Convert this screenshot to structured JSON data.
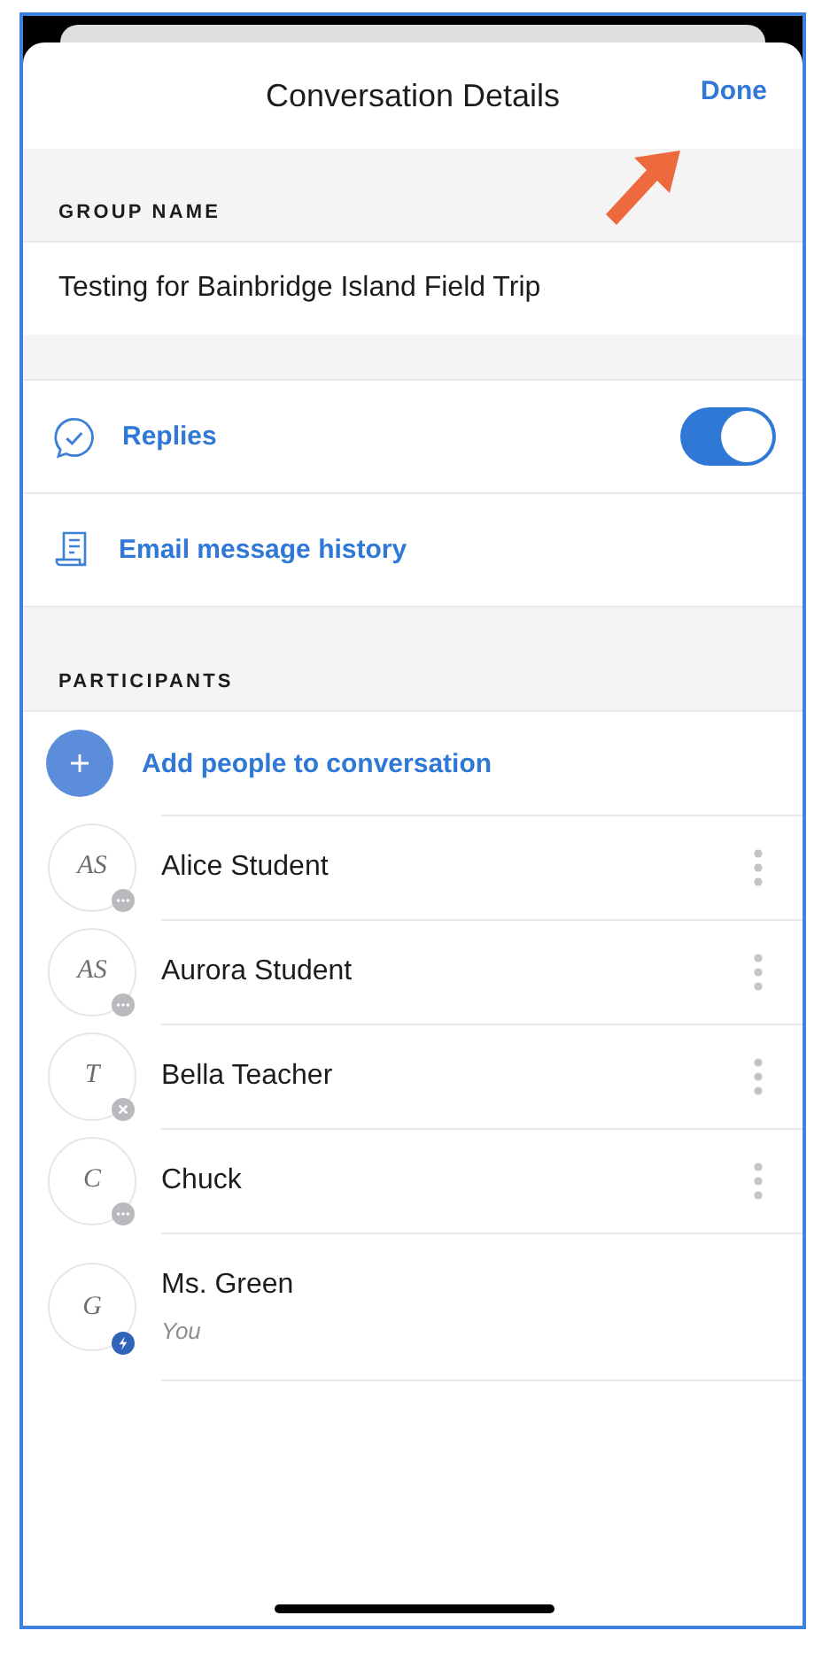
{
  "header": {
    "title": "Conversation Details",
    "done": "Done"
  },
  "group_name": {
    "label": "GROUP NAME",
    "value": "Testing for Bainbridge Island Field Trip"
  },
  "settings": [
    {
      "kind": "toggle",
      "label": "Replies",
      "on": true
    },
    {
      "kind": "link",
      "label": "Email message history"
    }
  ],
  "participants": {
    "label": "PARTICIPANTS",
    "add": "Add people to conversation",
    "items": [
      {
        "initials": "AS",
        "name": "Alice Student",
        "kind": "more",
        "menu": true
      },
      {
        "initials": "AS",
        "name": "Aurora Student",
        "kind": "more",
        "menu": true
      },
      {
        "initials": "T",
        "name": "Bella Teacher",
        "kind": "blocked",
        "menu": true
      },
      {
        "initials": "C",
        "name": "Chuck",
        "kind": "more",
        "menu": true
      },
      {
        "initials": "G",
        "name": "Ms. Green",
        "subtitle": "You",
        "kind": "bolt",
        "menu": false
      }
    ]
  }
}
